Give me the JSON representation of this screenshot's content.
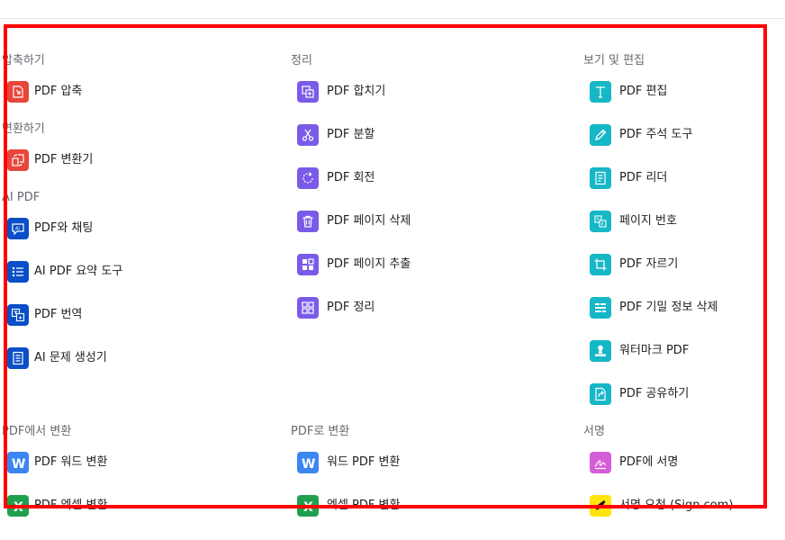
{
  "menu": {
    "columns": [
      {
        "sections": [
          {
            "title": "압축하기",
            "items": [
              {
                "label": "PDF 압축",
                "icon": "compress-icon",
                "color": "#e9453a"
              }
            ]
          },
          {
            "title": "변환하기",
            "items": [
              {
                "label": "PDF 변환기",
                "icon": "convert-icon",
                "color": "#e9453a"
              }
            ]
          },
          {
            "title": "AI PDF",
            "items": [
              {
                "label": "PDF와 채팅",
                "icon": "ai-chat-icon",
                "color": "#0a4fc7"
              },
              {
                "label": "AI PDF 요약 도구",
                "icon": "list-summary-icon",
                "color": "#0a4fc7"
              },
              {
                "label": "PDF 번역",
                "icon": "translate-icon",
                "color": "#0a4fc7"
              },
              {
                "label": "AI 문제 생성기",
                "icon": "question-generator-icon",
                "color": "#0a4fc7"
              }
            ]
          },
          {
            "title": "PDF에서 변환",
            "items": [
              {
                "label": "PDF 워드 변환",
                "icon": "word-icon",
                "color": "#3b86f0"
              },
              {
                "label": "PDF 엑셀 변환",
                "icon": "excel-icon",
                "color": "#20a04f"
              }
            ]
          }
        ]
      },
      {
        "sections": [
          {
            "title": "정리",
            "items": [
              {
                "label": "PDF 합치기",
                "icon": "merge-icon",
                "color": "#7a5be8"
              },
              {
                "label": "PDF 분할",
                "icon": "scissors-icon",
                "color": "#7a5be8"
              },
              {
                "label": "PDF 회전",
                "icon": "rotate-icon",
                "color": "#7a5be8"
              },
              {
                "label": "PDF 페이지 삭제",
                "icon": "trash-icon",
                "color": "#7a5be8"
              },
              {
                "label": "PDF 페이지 추출",
                "icon": "extract-icon",
                "color": "#7a5be8"
              },
              {
                "label": "PDF 정리",
                "icon": "grid-icon",
                "color": "#7a5be8"
              }
            ]
          },
          {
            "title": "PDF로 변환",
            "items": [
              {
                "label": "워드 PDF 변환",
                "icon": "word-icon",
                "color": "#3b86f0"
              },
              {
                "label": "엑셀 PDF 변환",
                "icon": "excel-icon",
                "color": "#20a04f"
              }
            ]
          }
        ]
      },
      {
        "sections": [
          {
            "title": "보기 및 편집",
            "items": [
              {
                "label": "PDF 편집",
                "icon": "text-edit-icon",
                "color": "#16b7c6"
              },
              {
                "label": "PDF 주석 도구",
                "icon": "pencil-icon",
                "color": "#16b7c6"
              },
              {
                "label": "PDF 리더",
                "icon": "reader-icon",
                "color": "#16b7c6"
              },
              {
                "label": "페이지 번호",
                "icon": "page-number-icon",
                "color": "#16b7c6"
              },
              {
                "label": "PDF 자르기",
                "icon": "crop-icon",
                "color": "#16b7c6"
              },
              {
                "label": "PDF 기밀 정보 삭제",
                "icon": "redact-icon",
                "color": "#16b7c6"
              },
              {
                "label": "워터마크 PDF",
                "icon": "watermark-icon",
                "color": "#16b7c6"
              },
              {
                "label": "PDF 공유하기",
                "icon": "share-icon",
                "color": "#16b7c6"
              }
            ]
          },
          {
            "title": "서명",
            "items": [
              {
                "label": "PDF에 서명",
                "icon": "signature-icon",
                "color": "#d65dd8"
              },
              {
                "label": "서명 요청 (Sign.com)",
                "icon": "sign-com-icon",
                "color": "#ffe30f"
              }
            ]
          }
        ]
      }
    ]
  },
  "highlight": {
    "color": "#ff0000"
  }
}
